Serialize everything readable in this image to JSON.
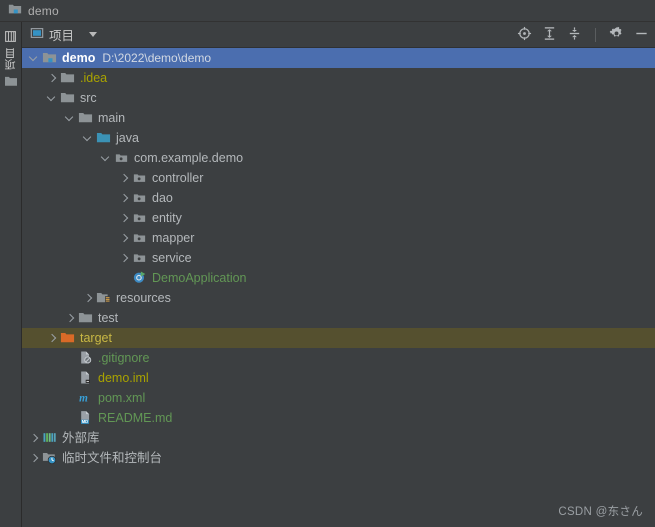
{
  "window": {
    "title": "demo",
    "title_icon": "module-folder-icon"
  },
  "toolbar": {
    "tab_label": "项目",
    "tab_icon": "project-view-icon",
    "dropdown_icon": "chevron-down-icon",
    "buttons": [
      {
        "name": "locate-icon",
        "label": ""
      },
      {
        "name": "expand-all-icon",
        "label": ""
      },
      {
        "name": "collapse-all-icon",
        "label": ""
      },
      {
        "name": "settings-gear-icon",
        "label": ""
      },
      {
        "name": "hide-minimize-icon",
        "label": ""
      }
    ]
  },
  "rail": {
    "tab_label": "项目",
    "top_icon": "project-tool-window-icon",
    "bottom_icon": "folder-icon"
  },
  "tree": {
    "rows": [
      {
        "indent": 0,
        "arrow": "down",
        "icon": "module-folder-icon",
        "label": "demo",
        "sub": "D:\\2022\\demo\\demo",
        "state": "selected",
        "color": "c-white"
      },
      {
        "indent": 1,
        "arrow": "right",
        "icon": "folder-icon",
        "label": ".idea",
        "sub": "",
        "state": "normal",
        "color": "c-olive"
      },
      {
        "indent": 1,
        "arrow": "down",
        "icon": "folder-icon",
        "label": "src",
        "sub": "",
        "state": "normal",
        "color": "c-grey"
      },
      {
        "indent": 2,
        "arrow": "down",
        "icon": "folder-icon",
        "label": "main",
        "sub": "",
        "state": "normal",
        "color": "c-grey"
      },
      {
        "indent": 3,
        "arrow": "down",
        "icon": "source-root-icon",
        "label": "java",
        "sub": "",
        "state": "normal",
        "color": "c-grey"
      },
      {
        "indent": 4,
        "arrow": "down",
        "icon": "package-icon",
        "label": "com.example.demo",
        "sub": "",
        "state": "normal",
        "color": "c-grey"
      },
      {
        "indent": 5,
        "arrow": "right",
        "icon": "package-icon",
        "label": "controller",
        "sub": "",
        "state": "normal",
        "color": "c-grey"
      },
      {
        "indent": 5,
        "arrow": "right",
        "icon": "package-icon",
        "label": "dao",
        "sub": "",
        "state": "normal",
        "color": "c-grey"
      },
      {
        "indent": 5,
        "arrow": "right",
        "icon": "package-icon",
        "label": "entity",
        "sub": "",
        "state": "normal",
        "color": "c-grey"
      },
      {
        "indent": 5,
        "arrow": "right",
        "icon": "package-icon",
        "label": "mapper",
        "sub": "",
        "state": "normal",
        "color": "c-grey"
      },
      {
        "indent": 5,
        "arrow": "right",
        "icon": "package-icon",
        "label": "service",
        "sub": "",
        "state": "normal",
        "color": "c-grey"
      },
      {
        "indent": 5,
        "arrow": "none",
        "icon": "spring-boot-run-icon",
        "label": "DemoApplication",
        "sub": "",
        "state": "normal",
        "color": "c-green"
      },
      {
        "indent": 3,
        "arrow": "right",
        "icon": "resource-root-icon",
        "label": "resources",
        "sub": "",
        "state": "normal",
        "color": "c-grey"
      },
      {
        "indent": 2,
        "arrow": "right",
        "icon": "folder-icon",
        "label": "test",
        "sub": "",
        "state": "normal",
        "color": "c-grey"
      },
      {
        "indent": 1,
        "arrow": "right",
        "icon": "excluded-folder-icon",
        "label": "target",
        "sub": "",
        "state": "excluded",
        "color": "c-target"
      },
      {
        "indent": 2,
        "arrow": "none",
        "icon": "gitignore-file-icon",
        "label": ".gitignore",
        "sub": "",
        "state": "normal",
        "color": "c-green"
      },
      {
        "indent": 2,
        "arrow": "none",
        "icon": "iml-file-icon",
        "label": "demo.iml",
        "sub": "",
        "state": "normal",
        "color": "c-olive"
      },
      {
        "indent": 2,
        "arrow": "none",
        "icon": "maven-pom-icon",
        "label": "pom.xml",
        "sub": "",
        "state": "normal",
        "color": "c-green"
      },
      {
        "indent": 2,
        "arrow": "none",
        "icon": "markdown-file-icon",
        "label": "README.md",
        "sub": "",
        "state": "normal",
        "color": "c-green"
      },
      {
        "indent": 0,
        "arrow": "right",
        "icon": "external-libraries-icon",
        "label": "外部库",
        "sub": "",
        "state": "normal",
        "color": "c-grey"
      },
      {
        "indent": 0,
        "arrow": "right",
        "icon": "scratches-icon",
        "label": "临时文件和控制台",
        "sub": "",
        "state": "normal",
        "color": "c-grey"
      }
    ]
  },
  "watermark": {
    "text": "CSDN @东さん"
  },
  "colors": {
    "background": "#3c3f41",
    "selection": "#4b6eaf",
    "excluded_row": "#55502f",
    "toolbar": "#3c3f41",
    "text": "#a9b7c6",
    "green_text": "#629755",
    "olive_text": "#a9a300"
  }
}
